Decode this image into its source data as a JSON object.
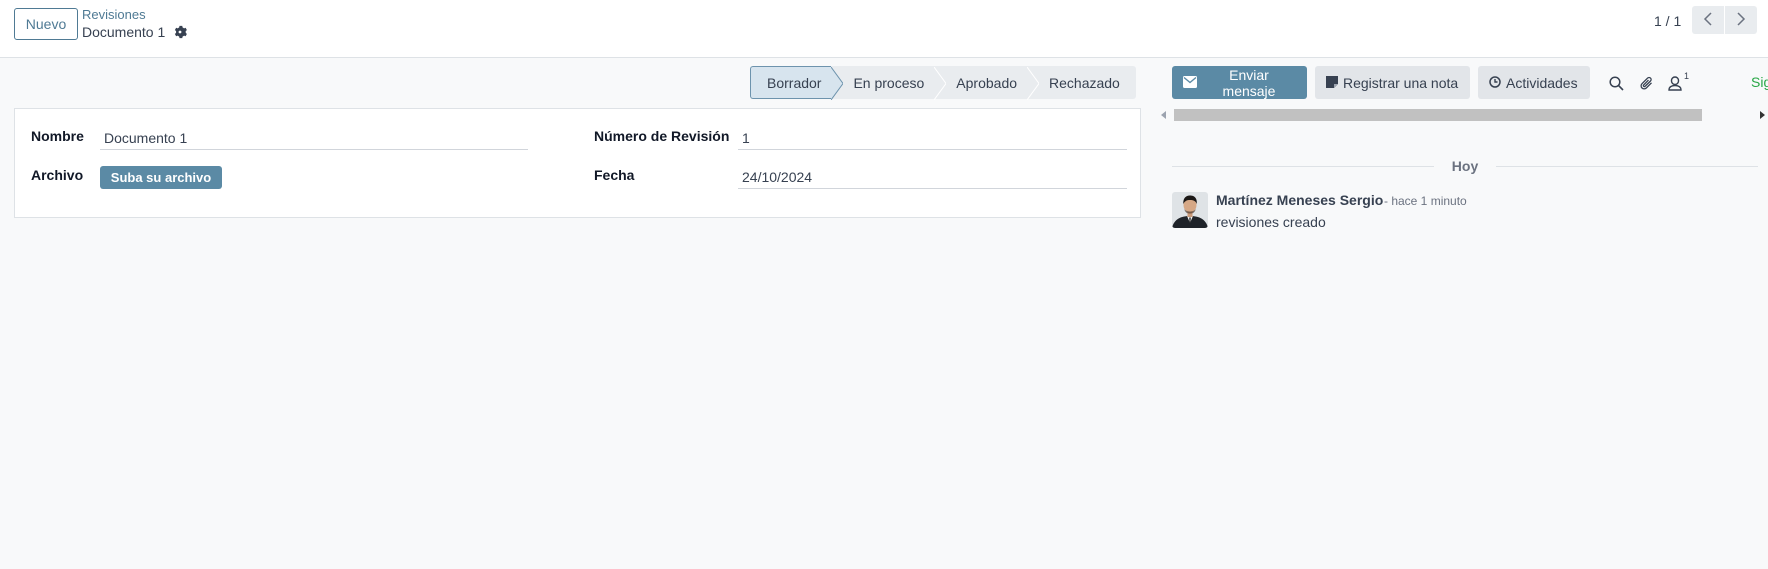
{
  "control_panel": {
    "new_button": "Nuevo",
    "breadcrumb_parent": "Revisiones",
    "breadcrumb_current": "Documento 1",
    "pager": "1 / 1"
  },
  "statusbar": {
    "stages": [
      "Borrador",
      "En proceso",
      "Aprobado",
      "Rechazado"
    ],
    "active": "Borrador"
  },
  "form": {
    "nombre_label": "Nombre",
    "nombre_value": "Documento 1",
    "archivo_label": "Archivo",
    "upload_button": "Suba su archivo",
    "revision_label": "Número de Revisión",
    "revision_value": "1",
    "fecha_label": "Fecha",
    "fecha_value": "24/10/2024"
  },
  "chatter": {
    "send_message": "Enviar mensaje",
    "log_note": "Registrar una nota",
    "activities": "Actividades",
    "followers_count": "1",
    "follow_label": "Sig",
    "day_separator": "Hoy",
    "messages": [
      {
        "author": "Martínez Meneses Sergio",
        "date": "- hace 1 minuto",
        "body": "revisiones creado"
      }
    ]
  },
  "colors": {
    "accent": "#4f7a94",
    "primary_button": "#5b8aa5",
    "active_stage": "#d7e4ee",
    "follow_link": "#28a745"
  },
  "icons": {
    "gear": "gear-icon",
    "prev": "chevron-left-icon",
    "next": "chevron-right-icon",
    "envelope": "envelope-icon",
    "note": "sticky-note-icon",
    "clock": "clock-icon",
    "search": "search-icon",
    "paperclip": "paperclip-icon",
    "user": "user-icon"
  }
}
